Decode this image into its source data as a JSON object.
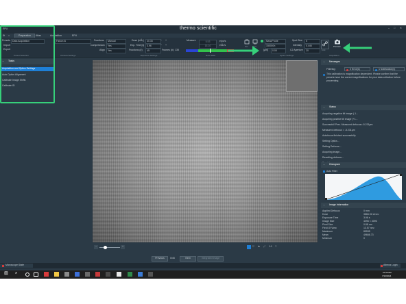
{
  "app": {
    "brand": "thermo scientific",
    "window_title": "EPU",
    "tabs": [
      "Preparation",
      "Atlas",
      "Acquisition",
      "EPU"
    ],
    "active_tab": "Preparation"
  },
  "ribbon": {
    "presets_label": "Presets",
    "presets_value": "Data Acquisition",
    "import": "Import",
    "export": "Export",
    "preset_selection_group": "Preset Selection",
    "camera_value": "Falcon 4i",
    "fraction_label": "Fractions",
    "fraction_value": "Manual",
    "compression_label": "Compression",
    "compression_value": "Yes",
    "align_label": "Align",
    "align_value": "Yes",
    "camera_settings_group": "Camera Settings",
    "dose_label": "Dose [e/Å²]",
    "dose_value": "40.33",
    "exp_time_label": "Exp. Time [s]",
    "exp_time_value": "3.96",
    "fractions_label": "Fractions (#)",
    "fractions_value": "45",
    "frames_label": "Frames (#): 135",
    "exposure_settings_group": "Exposure Settings",
    "measure_label": "Measure",
    "measure_v1": "5.53",
    "measure_v2": "15.10",
    "unit1": "e/px/s",
    "unit2": "e/Å²/s",
    "dose_rate_group": "Dose Rate",
    "optics_settings_group": "Optics Settings",
    "mode_value": "NanoProbe",
    "mag_value": "150000×",
    "defocus_label": "[µm]",
    "defocus_value": "0.00",
    "spot_label": "Spot Size",
    "spot_value": "5",
    "intensity_label": "Intensity",
    "intensity_value": "0.446",
    "c2_label": "C2 Aperture",
    "c2_value": "20",
    "preview_label": "Preview",
    "acquisition_group": "Acquisition",
    "set_label": "Set",
    "get_label": "Get",
    "link_label": "Link"
  },
  "left_panel": {
    "tasks_title": "Tasks",
    "tasks": [
      "Acquisition and Optics Settings",
      "Auto Optics Alignment",
      "Calibrate Image Shifts",
      "Calibrate ID"
    ],
    "selected_index": 0
  },
  "view_controls": {
    "zoom_label": "1:1",
    "fit_label": "Fit"
  },
  "nav": {
    "previous": "Previous",
    "page": "0/45",
    "next": "Next",
    "integrated": "Integrated Image"
  },
  "right_panel": {
    "messages_title": "Messages",
    "filtering_label": "Filtering:",
    "errors_chip": "0 Error(s)",
    "notifications_chip": "1 Notification(s)",
    "message_text": "This calibration is magnification dependent. Please confirm that the presets have the correct magnifications for your data collection before proceeding.",
    "status_title": "Status",
    "status_lines": [
      "Acquiring negative tilt image (-1...",
      "Acquiring positive tilt image (+1...",
      "Successful! Prev. Measured defocus=-5.231μm",
      "Measured defocus = -5.231μm",
      "Autofocus finished successfully.",
      "Setting Optics...",
      "Setting Defocus...",
      "Acquiring image...",
      "Resetting defocus...",
      "Ready!"
    ],
    "histogram_title": "Histogram",
    "auto_filter_label": "Auto Filter",
    "image_info_title": "Image Information",
    "info_rows": [
      [
        "Applied Defocus",
        "0 mm"
      ],
      [
        "Dose",
        "3866.92 e/nm²"
      ],
      [
        "Exposure Time",
        "3.96 s"
      ],
      [
        "Image Size",
        "4096 × 4096"
      ],
      [
        "Pixel Size",
        "0.88 nm"
      ],
      [
        "Field Of View",
        "13.57 nm²"
      ],
      [
        "Maximum",
        "85535"
      ],
      [
        "Mean",
        "49666.73"
      ],
      [
        "Minimum",
        "0"
      ]
    ]
  },
  "statusbar": {
    "microscope_state": "Microscope State",
    "user": "Athena Login"
  },
  "taskbar": {
    "time": "10:30 AM",
    "date": "7/16/2024"
  },
  "colors": {
    "accent_green": "#36d07a",
    "selection_blue": "#1e7fd6",
    "error_red": "#d83b3b",
    "histogram_blue": "#2f9be0"
  }
}
